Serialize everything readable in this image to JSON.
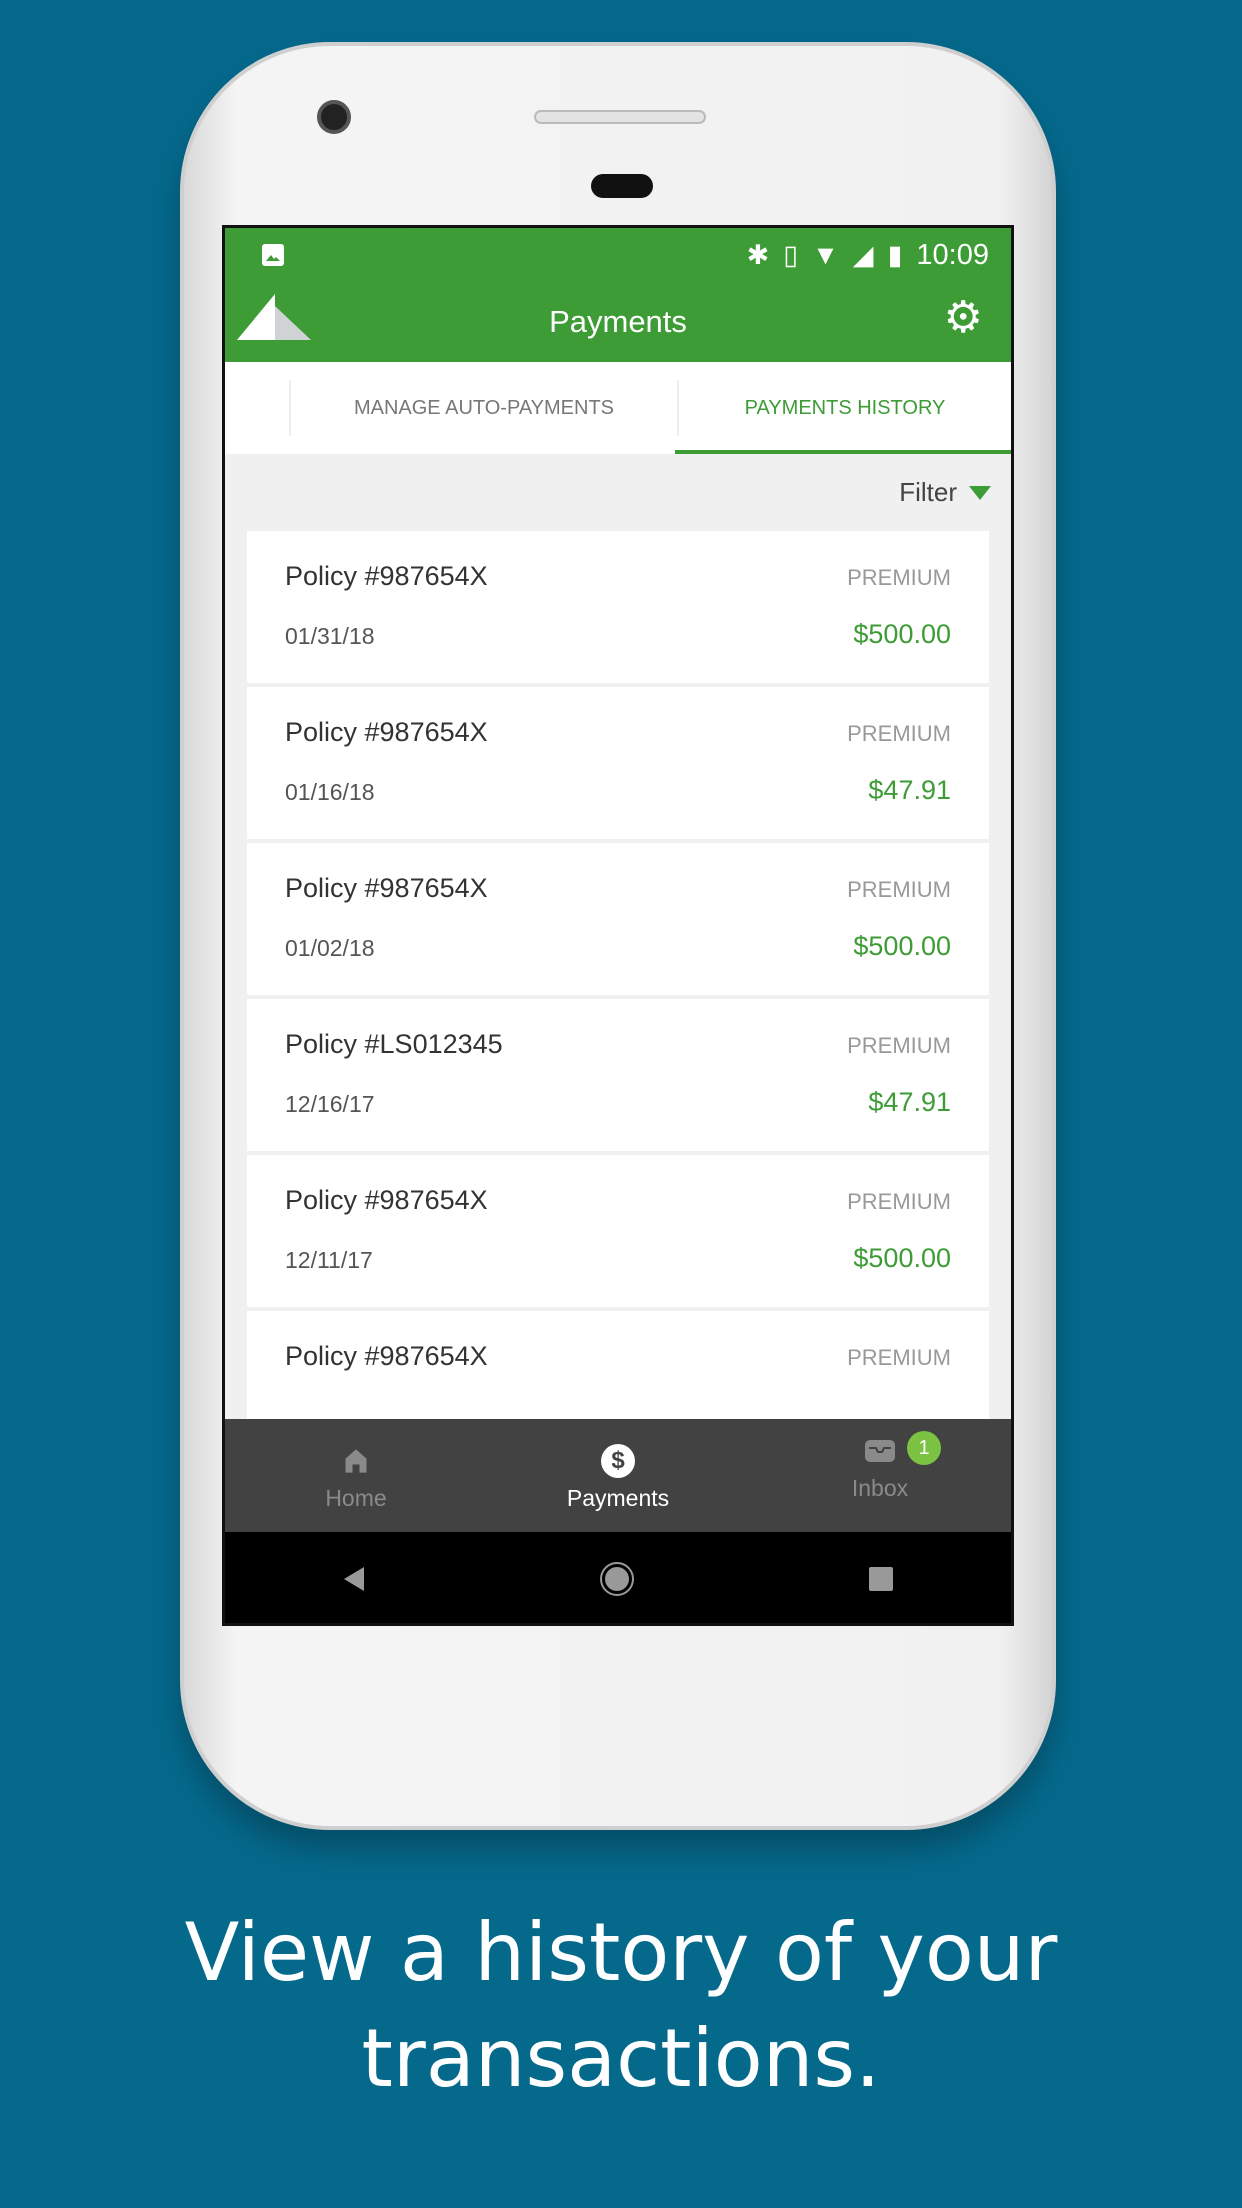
{
  "status_bar": {
    "time": "10:09",
    "icons": [
      "image-icon",
      "bluetooth-icon",
      "vibrate-icon",
      "wifi-icon",
      "signal-icon",
      "battery-icon"
    ]
  },
  "app_bar": {
    "title": "Payments",
    "settings_icon": "gear-icon"
  },
  "tabs": [
    {
      "label": "MANAGE AUTO-PAYMENTS",
      "active": false
    },
    {
      "label": "PAYMENTS HISTORY",
      "active": true
    }
  ],
  "filter": {
    "label": "Filter"
  },
  "payments": [
    {
      "policy": "Policy #987654X",
      "type": "PREMIUM",
      "date": "01/31/18",
      "amount": "$500.00"
    },
    {
      "policy": "Policy #987654X",
      "type": "PREMIUM",
      "date": "01/16/18",
      "amount": "$47.91"
    },
    {
      "policy": "Policy #987654X",
      "type": "PREMIUM",
      "date": "01/02/18",
      "amount": "$500.00"
    },
    {
      "policy": "Policy #LS012345",
      "type": "PREMIUM",
      "date": "12/16/17",
      "amount": "$47.91"
    },
    {
      "policy": "Policy #987654X",
      "type": "PREMIUM",
      "date": "12/11/17",
      "amount": "$500.00"
    },
    {
      "policy": "Policy #987654X",
      "type": "PREMIUM"
    }
  ],
  "bottom_nav": [
    {
      "label": "Home",
      "active": false
    },
    {
      "label": "Payments",
      "active": true
    },
    {
      "label": "Inbox",
      "active": false,
      "badge": "1"
    }
  ],
  "caption": {
    "line1": "View a history of your",
    "line2": "transactions."
  },
  "colors": {
    "brand_green": "#3d9c35",
    "background": "#05698c",
    "badge": "#7cc242"
  }
}
